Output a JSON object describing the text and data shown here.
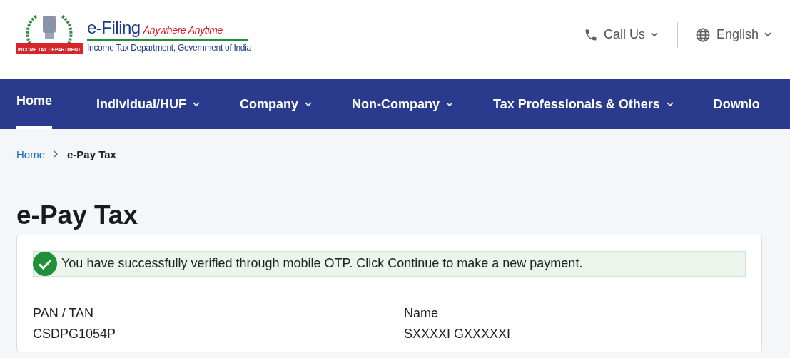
{
  "header": {
    "logo": {
      "ribbon": "INCOME TAX DEPARTMENT",
      "title": "e-Filing",
      "tagline": "Anywhere Anytime",
      "subtitle": "Income Tax Department, Government of India"
    },
    "actions": [
      {
        "kind": "phone",
        "label": "Call Us"
      },
      {
        "kind": "globe",
        "label": "English"
      }
    ]
  },
  "nav": [
    {
      "label": "Home",
      "selected": true,
      "dropdown": false
    },
    {
      "label": "Individual/HUF",
      "selected": false,
      "dropdown": true
    },
    {
      "label": "Company",
      "selected": false,
      "dropdown": true
    },
    {
      "label": "Non-Company",
      "selected": false,
      "dropdown": true
    },
    {
      "label": "Tax Professionals & Others",
      "selected": false,
      "dropdown": true
    },
    {
      "label": "Downlo",
      "selected": false,
      "dropdown": false
    }
  ],
  "breadcrumb": [
    {
      "label": "Home",
      "link": true
    },
    {
      "label": "e-Pay Tax",
      "link": false
    }
  ],
  "page_title": "e-Pay Tax",
  "alert": {
    "kind": "success",
    "message": "You have successfully verified through mobile OTP. Click Continue to make a new payment."
  },
  "fields": [
    {
      "label": "PAN / TAN",
      "value": "CSDPG1054P"
    },
    {
      "label": "Name",
      "value": "SXXXXI GXXXXXI"
    }
  ]
}
